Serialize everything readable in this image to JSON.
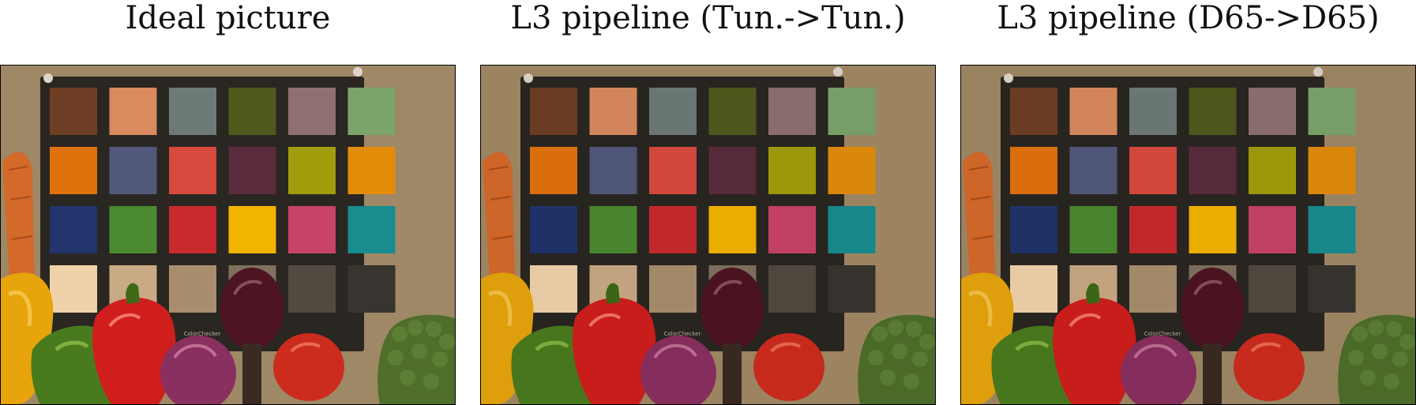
{
  "panels": [
    {
      "title": "Ideal picture",
      "tint": "#b9a07a"
    },
    {
      "title": "L3 pipeline (Tun.->Tun.)",
      "tint": "#bfa27a"
    },
    {
      "title": "L3 pipeline (D65->D65)",
      "tint": "#bba07b"
    }
  ],
  "chart_label": "ColorChecker",
  "patch_colors": [
    [
      "#6e3e24",
      "#d98a5e",
      "#6e7a78",
      "#4e5a1c",
      "#8e7072",
      "#7aa46a"
    ],
    [
      "#e0720c",
      "#52587a",
      "#d84a3e",
      "#5a2c3e",
      "#a09c0c",
      "#e38c0a"
    ],
    [
      "#21346c",
      "#4b8a30",
      "#c82a2e",
      "#f2b400",
      "#c84466",
      "#188c8e"
    ],
    [
      "#f0d2aa",
      "#c8aa84",
      "#a88e6e",
      "#80705e",
      "#524a40",
      "#383430"
    ]
  ]
}
